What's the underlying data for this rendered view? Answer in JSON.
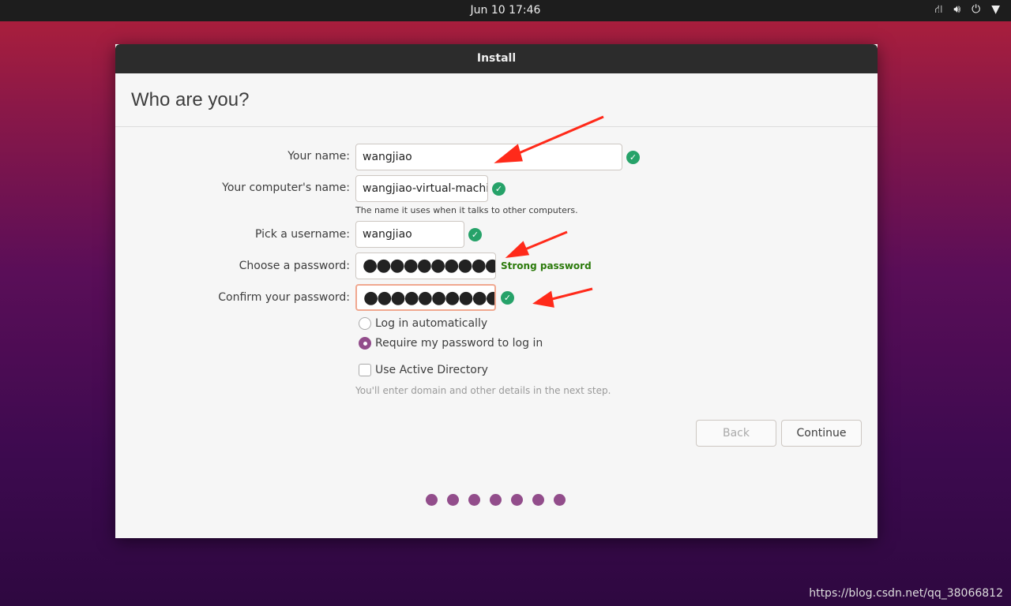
{
  "topbar": {
    "clock": "Jun 10  17:46",
    "icons": [
      "network-icon",
      "volume-icon",
      "power-icon",
      "menu-down-icon"
    ]
  },
  "window": {
    "title": "Install",
    "heading": "Who are you?"
  },
  "form": {
    "name_label": "Your name:",
    "name_value": "wangjiao",
    "computer_label": "Your computer's name:",
    "computer_value": "wangjiao-virtual-machi",
    "computer_hint": "The name it uses when it talks to other computers.",
    "username_label": "Pick a username:",
    "username_value": "wangjiao",
    "password_label": "Choose a password:",
    "password_value": "●●●●●●●●●●●●",
    "password_strength": "Strong password",
    "confirm_label": "Confirm your password:",
    "confirm_value": "●●●●●●●●●●●●",
    "login_auto": "Log in automatically",
    "login_require": "Require my password to log in",
    "login_selected": "require",
    "active_directory": "Use Active Directory",
    "active_directory_checked": false,
    "ad_hint": "You'll enter domain and other details in the next step."
  },
  "buttons": {
    "back": "Back",
    "continue": "Continue"
  },
  "progress": {
    "steps": 7
  },
  "watermark": "https://blog.csdn.net/qq_38066812",
  "colors": {
    "accent": "#924d8b",
    "ok": "#26a269",
    "annotation": "#ff2a1a"
  }
}
